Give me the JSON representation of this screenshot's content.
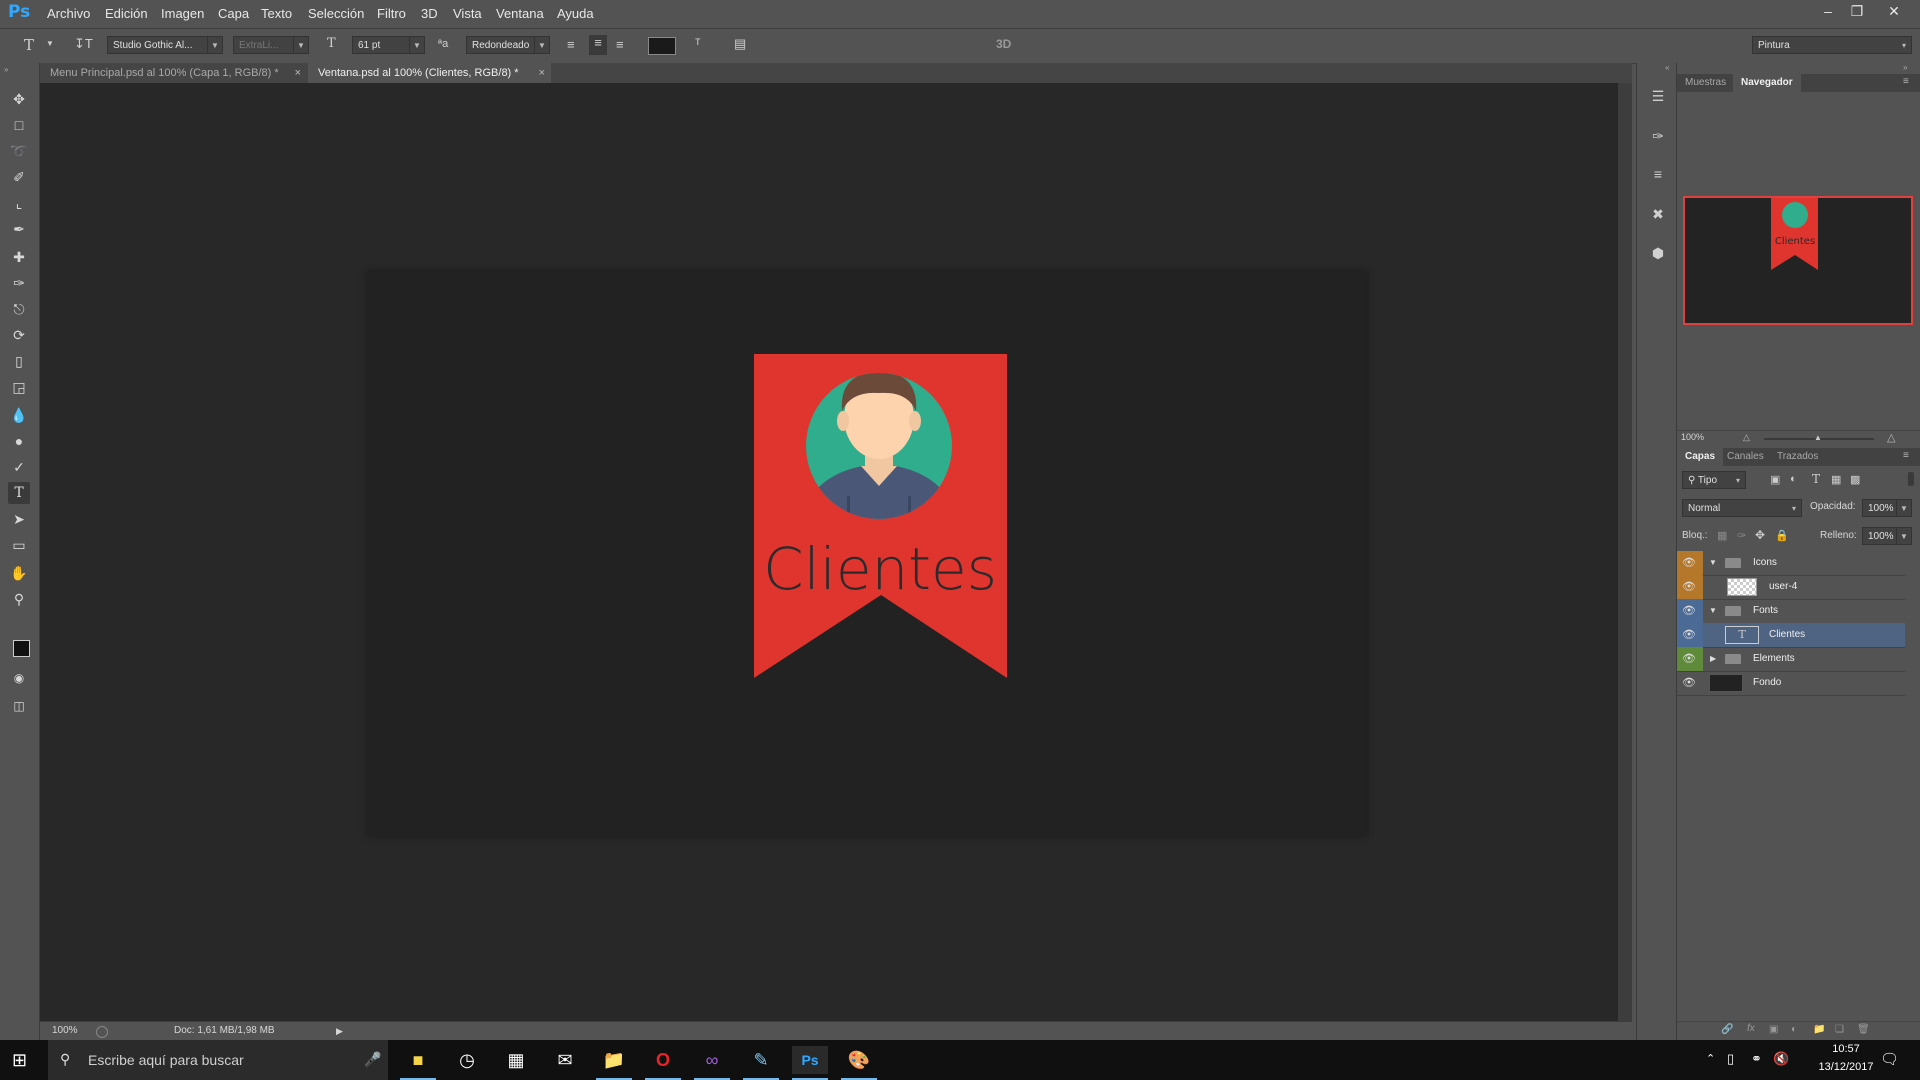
{
  "app": {
    "logo": "Ps",
    "accent": "#31a8ff"
  },
  "menu": [
    "Archivo",
    "Edición",
    "Imagen",
    "Capa",
    "Texto",
    "Selección",
    "Filtro",
    "3D",
    "Vista",
    "Ventana",
    "Ayuda"
  ],
  "window_controls": [
    "minimize-icon",
    "restore-icon",
    "close-icon"
  ],
  "options_bar": {
    "font_family": "Studio Gothic Al...",
    "font_style": "ExtraLi...",
    "font_size": "61 pt",
    "antialias_label": "ªa",
    "antialias": "Redondeado",
    "mode_3d": "3D",
    "workspace": "Pintura",
    "text_color": "#1a1a1a"
  },
  "tabs": [
    {
      "label": "Menu Principal.psd al 100% (Capa 1, RGB/8) *",
      "active": false
    },
    {
      "label": "Ventana.psd al 100% (Clientes, RGB/8) *",
      "active": true
    }
  ],
  "tools": [
    "move-tool-icon",
    "marquee-tool-icon",
    "lasso-tool-icon",
    "quick-select-tool-icon",
    "crop-tool-icon",
    "eyedropper-tool-icon",
    "healing-brush-icon",
    "brush-tool-icon",
    "clone-stamp-icon",
    "history-brush-icon",
    "eraser-tool-icon",
    "paint-bucket-icon",
    "blur-tool-icon",
    "dodge-tool-icon",
    "pen-tool-icon",
    "type-tool-icon",
    "path-select-icon",
    "rectangle-tool-icon",
    "hand-tool-icon",
    "zoom-tool-icon"
  ],
  "canvas": {
    "banner_color": "#e0342f",
    "circle_color": "#2fad8c",
    "banner_text": "Clientes"
  },
  "status": {
    "zoom": "100%",
    "doc": "Doc: 1,61 MB/1,98 MB"
  },
  "navigator": {
    "tabs": [
      "Muestras",
      "Navegador"
    ],
    "active_tab": "Navegador",
    "zoom": "100%",
    "preview_text": "Clientes"
  },
  "layers_panel": {
    "tabs": [
      "Capas",
      "Canales",
      "Trazados"
    ],
    "active_tab": "Capas",
    "filter": "Tipo",
    "blend_mode": "Normal",
    "opacity_label": "Opacidad:",
    "opacity": "100%",
    "lock_label": "Bloq.:",
    "fill_label": "Relleno:",
    "fill": "100%",
    "layers": [
      {
        "name": "Icons",
        "kind": "group",
        "expanded": true,
        "label_color": "#b5772a",
        "selected": false
      },
      {
        "name": "user-4",
        "kind": "smart",
        "label_color": "#b5772a",
        "selected": false
      },
      {
        "name": "Fonts",
        "kind": "group",
        "expanded": true,
        "label_color": "#4b6a95",
        "selected": false
      },
      {
        "name": "Clientes",
        "kind": "text",
        "label_color": "#4b6a95",
        "selected": true
      },
      {
        "name": "Elements",
        "kind": "group",
        "expanded": false,
        "label_color": "#5e8a3a",
        "selected": false
      },
      {
        "name": "Fondo",
        "kind": "background",
        "label_color": "",
        "selected": false
      }
    ]
  },
  "taskbar": {
    "search_placeholder": "Escribe aquí para buscar",
    "apps": [
      "sticky-notes-icon",
      "alarm-clock-icon",
      "calendar-icon",
      "mail-icon",
      "file-explorer-icon",
      "opera-icon",
      "visual-studio-icon",
      "notepad-icon",
      "photoshop-icon",
      "paint-icon"
    ],
    "time": "10:57",
    "date": "13/12/2017"
  }
}
